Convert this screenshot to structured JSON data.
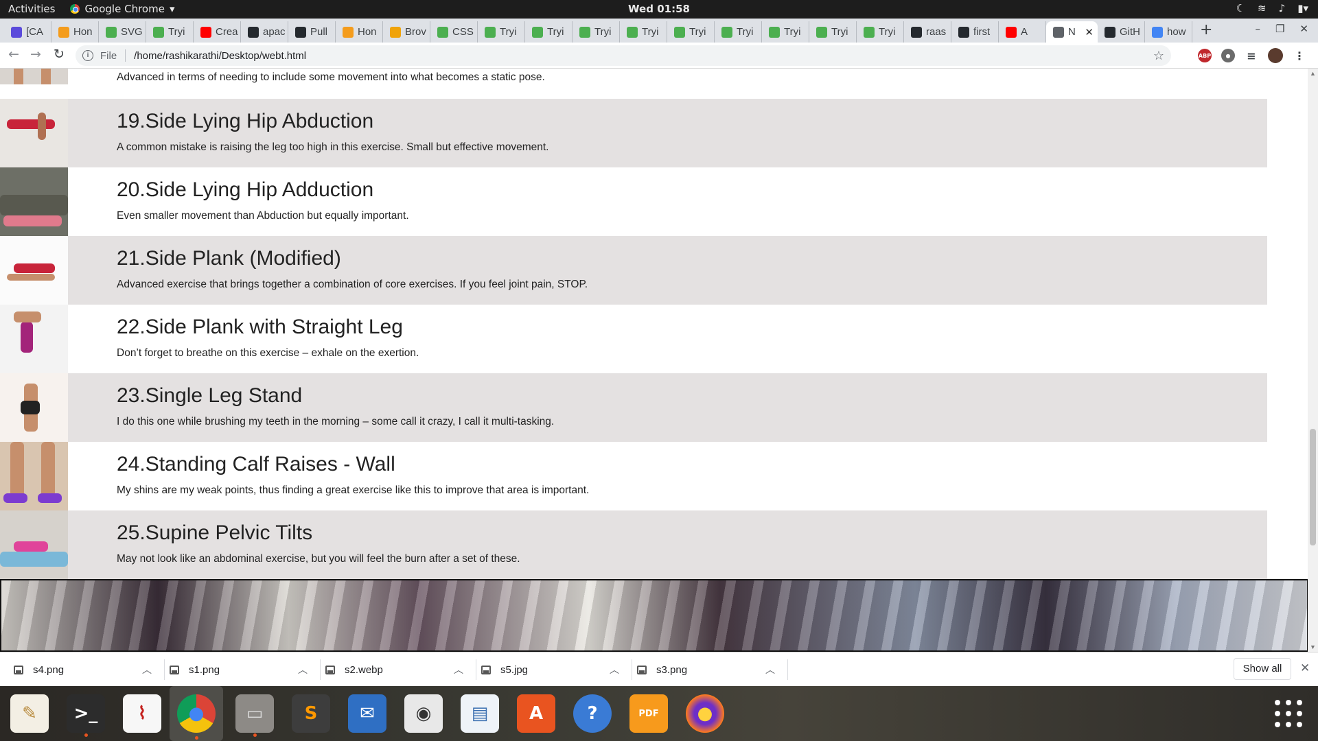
{
  "topbar": {
    "activities": "Activities",
    "app_name": "Google Chrome",
    "app_menu_arrow": "▾",
    "clock": "Wed 01:58"
  },
  "tabs": [
    {
      "label": "[CA",
      "favicon": "diamond-icon",
      "color": "#5b4bdb"
    },
    {
      "label": "Hon",
      "favicon": "swirl-icon",
      "color": "#f49c1c"
    },
    {
      "label": "SVG",
      "favicon": "w3schools-icon",
      "color": "#4caf50"
    },
    {
      "label": "Tryi",
      "favicon": "w3schools-icon",
      "color": "#4caf50"
    },
    {
      "label": "Crea",
      "favicon": "youtube-icon",
      "color": "#ff0000"
    },
    {
      "label": "apac",
      "favicon": "github-icon",
      "color": "#24292e"
    },
    {
      "label": "Pull",
      "favicon": "github-icon",
      "color": "#24292e"
    },
    {
      "label": "Hon",
      "favicon": "swirl-icon",
      "color": "#f49c1c"
    },
    {
      "label": "Brov",
      "favicon": "r-icon",
      "color": "#f0a30a"
    },
    {
      "label": "CSS",
      "favicon": "w3schools-icon",
      "color": "#4caf50"
    },
    {
      "label": "Tryi",
      "favicon": "w3schools-icon",
      "color": "#4caf50"
    },
    {
      "label": "Tryi",
      "favicon": "w3schools-icon",
      "color": "#4caf50"
    },
    {
      "label": "Tryi",
      "favicon": "w3schools-icon",
      "color": "#4caf50"
    },
    {
      "label": "Tryi",
      "favicon": "w3schools-icon",
      "color": "#4caf50"
    },
    {
      "label": "Tryi",
      "favicon": "w3schools-icon",
      "color": "#4caf50"
    },
    {
      "label": "Tryi",
      "favicon": "w3schools-icon",
      "color": "#4caf50"
    },
    {
      "label": "Tryi",
      "favicon": "w3schools-icon",
      "color": "#4caf50"
    },
    {
      "label": "Tryi",
      "favicon": "w3schools-icon",
      "color": "#4caf50"
    },
    {
      "label": "Tryi",
      "favicon": "w3schools-icon",
      "color": "#4caf50"
    },
    {
      "label": "raas",
      "favicon": "github-icon",
      "color": "#24292e"
    },
    {
      "label": "first",
      "favicon": "github-icon",
      "color": "#24292e"
    },
    {
      "label": "A",
      "favicon": "youtube-icon",
      "color": "#ff0000"
    },
    {
      "label": "N",
      "favicon": "globe-icon",
      "color": "#5f6368",
      "active": true
    },
    {
      "label": "GitH",
      "favicon": "github-icon",
      "color": "#24292e"
    },
    {
      "label": "how",
      "favicon": "google-icon",
      "color": "#4285f4"
    }
  ],
  "toolbar": {
    "scheme": "File",
    "url": "/home/rashikarathi/Desktop/webt.html"
  },
  "page": {
    "partial_row_text": "Advanced in terms of needing to include some movement into what becomes a static pose.",
    "exercises": [
      {
        "title": "19.Side Lying Hip Abduction",
        "desc": "A common mistake is raising the leg too high in this exercise.  Small but effective movement."
      },
      {
        "title": "20.Side Lying Hip Adduction",
        "desc": "Even smaller movement than Abduction but equally important."
      },
      {
        "title": "21.Side Plank (Modified)",
        "desc": "Advanced exercise that brings together a combination of core exercises.  If you feel joint pain, STOP."
      },
      {
        "title": "22.Side Plank with Straight Leg",
        "desc": "Don’t forget to breathe on this exercise – exhale on the exertion."
      },
      {
        "title": "23.Single Leg Stand",
        "desc": "I do this one while brushing my teeth in the morning – some call it crazy, I call it multi-tasking."
      },
      {
        "title": "24.Standing Calf Raises - Wall",
        "desc": "My shins are my weak points, thus finding a great exercise like this to improve that area is important."
      },
      {
        "title": "25.Supine Pelvic Tilts",
        "desc": "May not look like an abdominal exercise, but you will feel the burn after a set of these."
      }
    ]
  },
  "downloads": {
    "files": [
      "s4.png",
      "s1.png",
      "s2.webp",
      "s5.jpg",
      "s3.png"
    ],
    "show_all": "Show all"
  },
  "dock": [
    "text-editor-icon",
    "terminal-icon",
    "document-viewer-icon",
    "chrome-icon",
    "file-manager-icon",
    "sublime-text-icon",
    "thunderbird-icon",
    "rhythmbox-icon",
    "image-viewer-icon",
    "software-center-icon",
    "help-icon",
    "pdf-editor-icon",
    "firefox-icon"
  ]
}
